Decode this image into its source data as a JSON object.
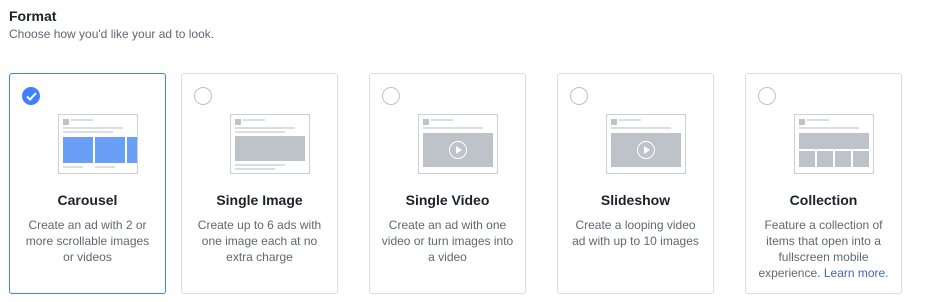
{
  "header": {
    "title": "Format",
    "subtitle": "Choose how you'd like your ad to look."
  },
  "formats": [
    {
      "title": "Carousel",
      "description": "Create an ad with 2 or more scrollable images or videos",
      "selected": true
    },
    {
      "title": "Single Image",
      "description": "Create up to 6 ads with one image each at no extra charge",
      "selected": false
    },
    {
      "title": "Single Video",
      "description": "Create an ad with one video or turn images into a video",
      "selected": false
    },
    {
      "title": "Slideshow",
      "description": "Create a looping video ad with up to 10 images",
      "selected": false
    },
    {
      "title": "Collection",
      "description": "Feature a collection of items that open into a fullscreen mobile experience.",
      "link": "Learn more.",
      "selected": false
    }
  ],
  "colors": {
    "accent": "#4080ff",
    "link": "#4267b2"
  },
  "icons": {
    "selected": "checkmark-icon",
    "video": "play-icon"
  }
}
